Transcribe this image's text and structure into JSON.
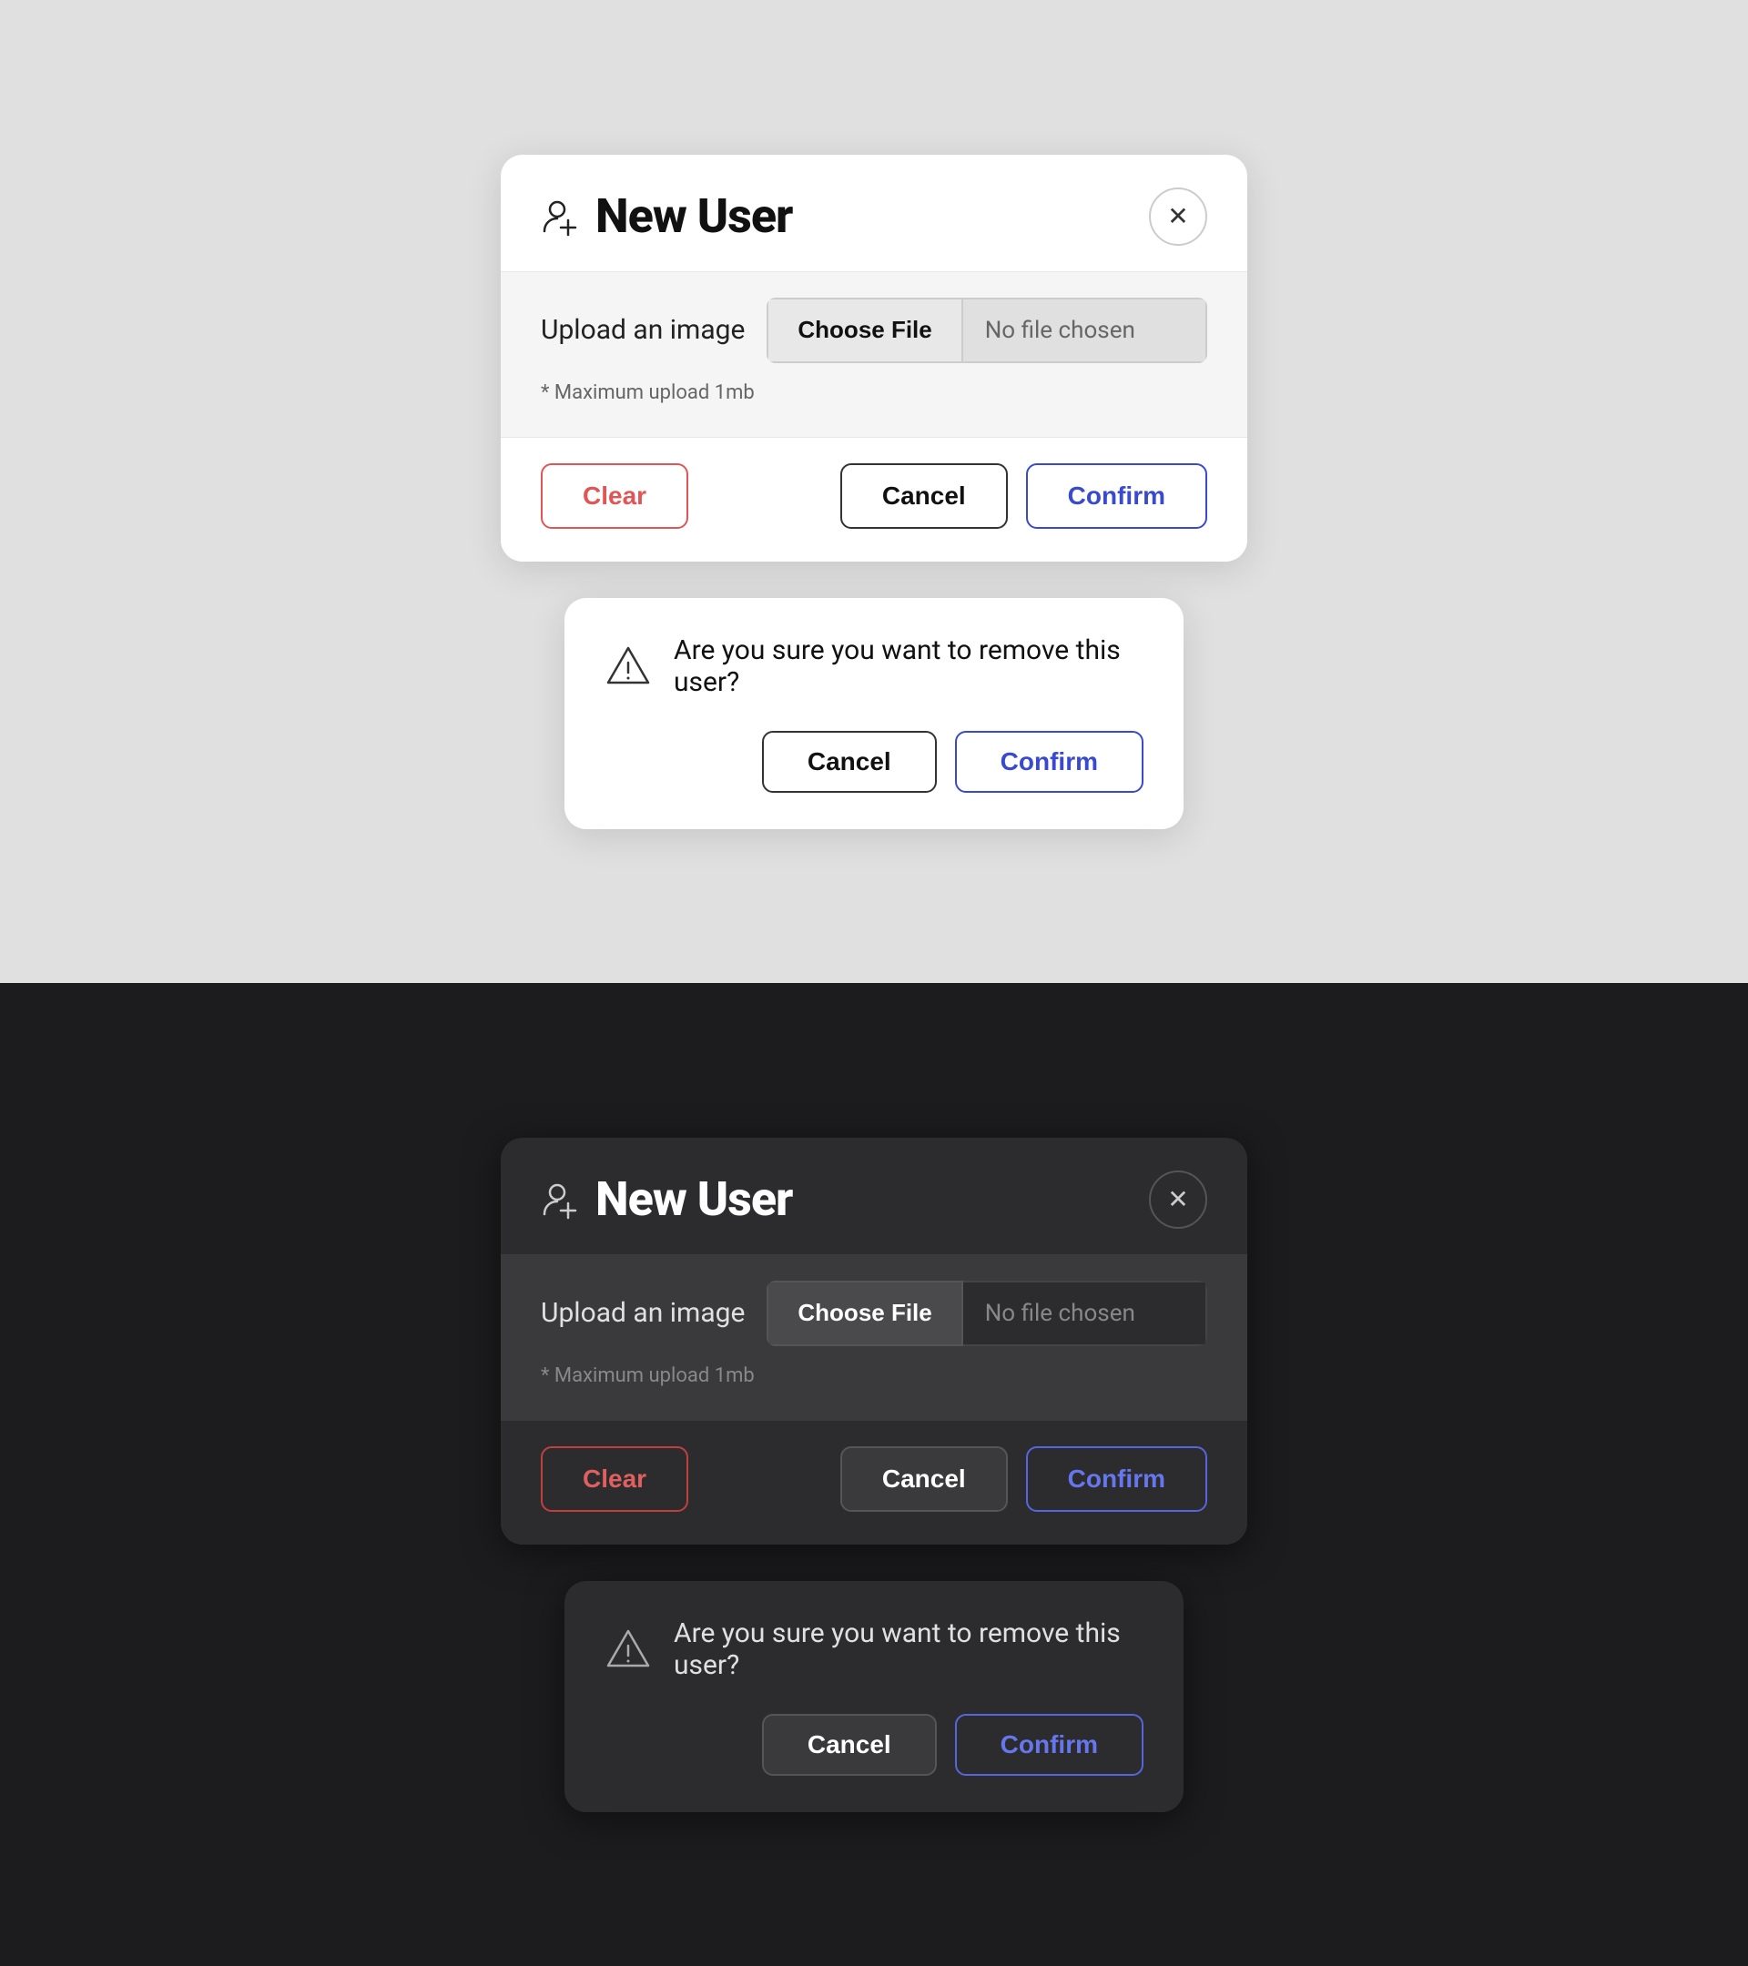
{
  "light": {
    "theme": "light",
    "modal": {
      "title": "New User",
      "close_label": "✕",
      "upload_label": "Upload an image",
      "choose_file_label": "Choose File",
      "no_file_label": "No file chosen",
      "max_upload_note": "* Maximum upload 1mb",
      "clear_label": "Clear",
      "cancel_label": "Cancel",
      "confirm_label": "Confirm"
    },
    "confirm_dialog": {
      "message": "Are you sure you want to remove this user?",
      "cancel_label": "Cancel",
      "confirm_label": "Confirm"
    }
  },
  "dark": {
    "theme": "dark",
    "modal": {
      "title": "New User",
      "close_label": "✕",
      "upload_label": "Upload an image",
      "choose_file_label": "Choose File",
      "no_file_label": "No file chosen",
      "max_upload_note": "* Maximum upload 1mb",
      "clear_label": "Clear",
      "cancel_label": "Cancel",
      "confirm_label": "Confirm"
    },
    "confirm_dialog": {
      "message": "Are you sure you want to remove this user?",
      "cancel_label": "Cancel",
      "confirm_label": "Confirm"
    }
  }
}
